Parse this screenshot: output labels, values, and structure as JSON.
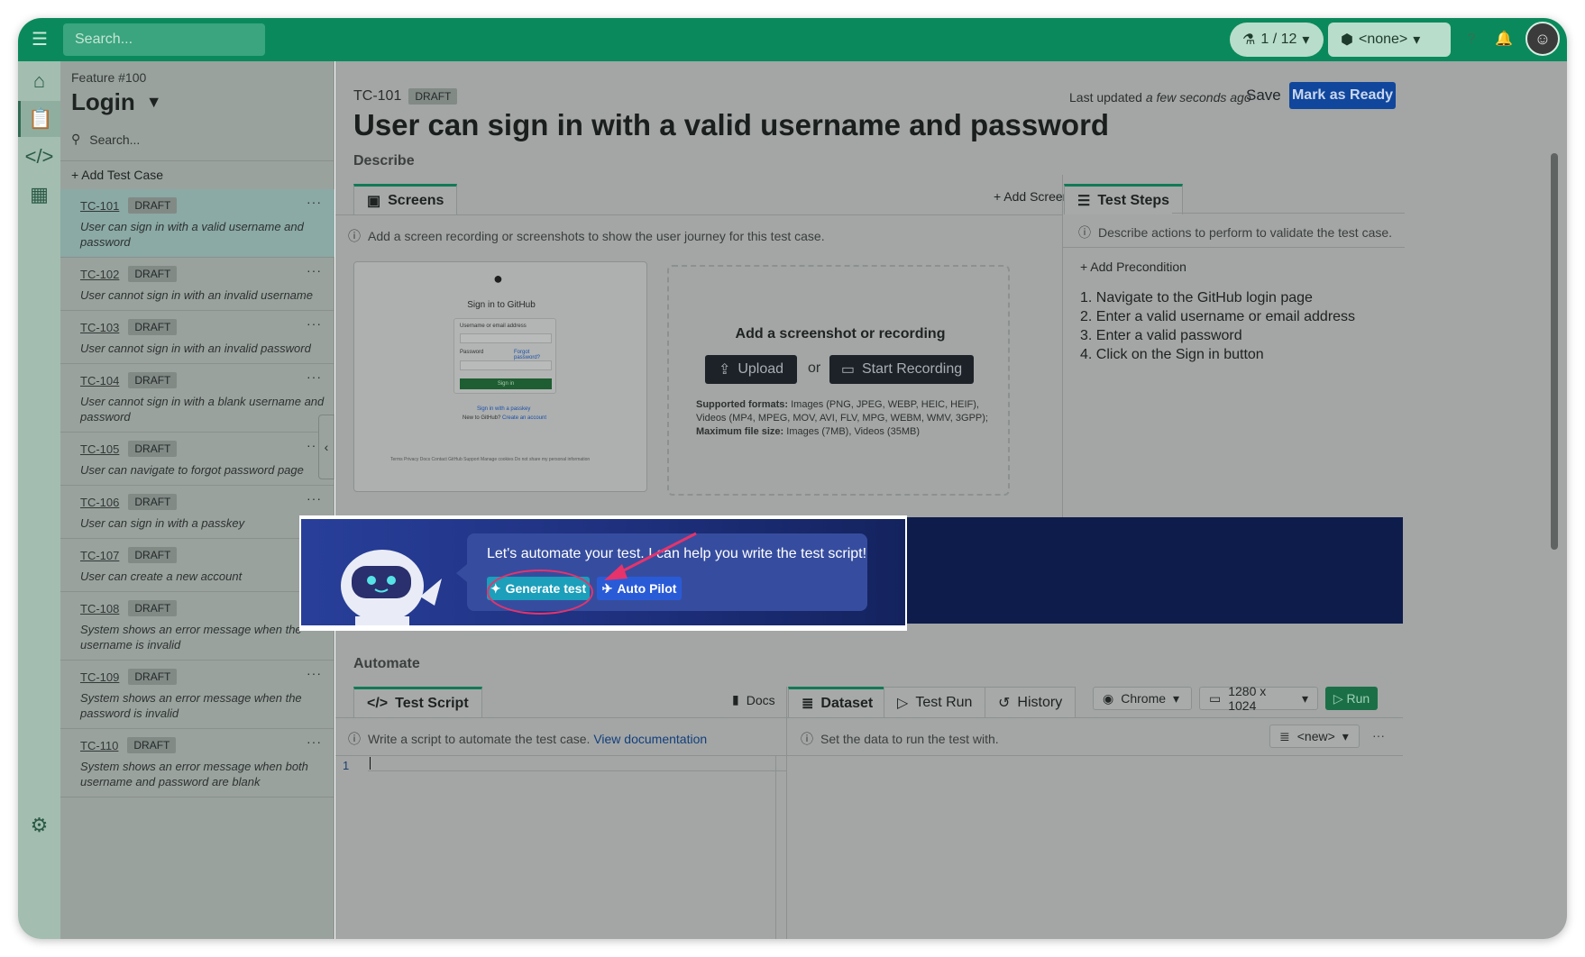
{
  "topbar": {
    "search_placeholder": "Search...",
    "runs": "1 / 12",
    "environment": "<none>"
  },
  "feature": {
    "label": "Feature #100",
    "title": "Login",
    "search_placeholder": "Search...",
    "add_test_case": "+ Add Test Case"
  },
  "test_cases": [
    {
      "id": "TC-101",
      "status": "DRAFT",
      "desc": "User can sign in with a valid username and password",
      "selected": true
    },
    {
      "id": "TC-102",
      "status": "DRAFT",
      "desc": "User cannot sign in with an invalid username"
    },
    {
      "id": "TC-103",
      "status": "DRAFT",
      "desc": "User cannot sign in with an invalid password"
    },
    {
      "id": "TC-104",
      "status": "DRAFT",
      "desc": "User cannot sign in with a blank username and password"
    },
    {
      "id": "TC-105",
      "status": "DRAFT",
      "desc": "User can navigate to forgot password page"
    },
    {
      "id": "TC-106",
      "status": "DRAFT",
      "desc": "User can sign in with a passkey"
    },
    {
      "id": "TC-107",
      "status": "DRAFT",
      "desc": "User can create a new account"
    },
    {
      "id": "TC-108",
      "status": "DRAFT",
      "desc": "System shows an error message when the username is invalid"
    },
    {
      "id": "TC-109",
      "status": "DRAFT",
      "desc": "System shows an error message when the password is invalid"
    },
    {
      "id": "TC-110",
      "status": "DRAFT",
      "desc": "System shows an error message when both username and password are blank"
    }
  ],
  "header": {
    "code": "TC-101",
    "status": "DRAFT",
    "title": "User can sign in with a valid username and password",
    "updated_prefix": "Last updated ",
    "updated_when": "a few seconds ago",
    "save": "Save",
    "mark_ready": "Mark as Ready"
  },
  "describe": {
    "heading": "Describe",
    "screens_tab": "Screens",
    "add_screen": "+ Add Screen",
    "screens_info": "Add a screen recording or screenshots to show the user journey for this test case.",
    "thumb": {
      "title": "Sign in to GitHub",
      "username_label": "Username or email address",
      "password_label": "Password",
      "forgot": "Forgot password?",
      "signin": "Sign in",
      "passkey": "Sign in with a passkey",
      "new_prefix": "New to GitHub? ",
      "create": "Create an account",
      "footer": "Terms   Privacy   Docs   Contact GitHub Support   Manage cookies   Do not share my personal information"
    },
    "drop": {
      "title": "Add a screenshot or recording",
      "upload": "Upload",
      "or": "or",
      "record": "Start Recording",
      "formats_label": "Supported formats:",
      "formats": " Images (PNG, JPEG, WEBP, HEIC, HEIF), Videos (MP4, MPEG, MOV, AVI, FLV, MPG, WEBM, WMV, 3GPP);",
      "maxsize_label": "Maximum file size:",
      "maxsize": " Images (7MB), Videos (35MB)"
    }
  },
  "steps": {
    "tab": "Test Steps",
    "info": "Describe actions to perform to validate the test case.",
    "add_precondition": "+ Add Precondition",
    "items": [
      "1. Navigate to the GitHub login page",
      "2. Enter a valid username or email address",
      "3. Enter a valid password",
      "4. Click on the Sign in button"
    ]
  },
  "banner": {
    "text": "Let's automate your test. I can help you write the test script!",
    "generate": "Generate test",
    "autopilot": "Auto Pilot"
  },
  "automate": {
    "heading": "Automate",
    "script_tab": "Test Script",
    "docs": "Docs",
    "info": "Write a script to automate the test case. ",
    "doc_link": "View documentation",
    "line_no": "1",
    "dataset_tab": "Dataset",
    "testrun_tab": "Test Run",
    "history_tab": "History",
    "browser": "Chrome",
    "resolution": "1280 x 1024",
    "run": "Run",
    "dataset_info": "Set the data to run the test with.",
    "dataset_select": "<new>"
  }
}
